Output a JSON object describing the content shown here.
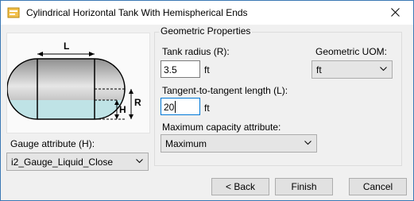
{
  "window": {
    "title": "Cylindrical Horizontal Tank With Hemispherical Ends"
  },
  "diagram": {
    "length_label": "L",
    "height_label": "H",
    "radius_label": "R"
  },
  "gauge": {
    "label": "Gauge attribute (H):",
    "selected": "i2_Gauge_Liquid_Close"
  },
  "geometric": {
    "group_title": "Geometric Properties",
    "radius_label": "Tank radius (R):",
    "radius_value": "3.5",
    "radius_unit": "ft",
    "length_label": "Tangent-to-tangent length (L):",
    "length_value": "20",
    "length_unit": "ft",
    "capacity_label": "Maximum capacity attribute:",
    "capacity_selected": "Maximum",
    "uom_label": "Geometric UOM:",
    "uom_selected": "ft"
  },
  "buttons": {
    "back": "< Back",
    "finish": "Finish",
    "cancel": "Cancel"
  },
  "colors": {
    "liquid": "#bfe3e6",
    "accent": "#0078d7"
  }
}
